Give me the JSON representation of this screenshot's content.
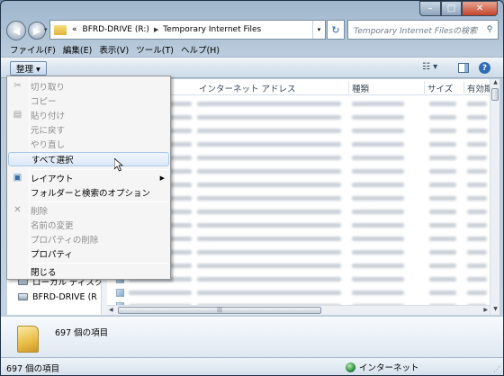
{
  "nav": {
    "address_prefix": "«",
    "address_segments": [
      "BFRD-DRIVE (R:)",
      "Temporary Internet Files"
    ],
    "search_placeholder": "Temporary Internet Filesの検索"
  },
  "window_controls": {
    "minimize": "–",
    "maximize": "□",
    "close": "✕"
  },
  "menubar": [
    "ファイル(F)",
    "編集(E)",
    "表示(V)",
    "ツール(T)",
    "ヘルプ(H)"
  ],
  "toolbar": {
    "organize": "整理 ▾",
    "view_icon": "☷ ▾",
    "help": "?"
  },
  "columns": [
    "インターネット アドレス",
    "種類",
    "サイズ",
    "有効期"
  ],
  "left_pane": {
    "items": [
      "ローカル ディスク",
      "BFRD-DRIVE (R"
    ]
  },
  "context_menu": {
    "items": [
      {
        "label": "切り取り",
        "disabled": true,
        "icon": "scissors-icon"
      },
      {
        "label": "コピー",
        "disabled": true
      },
      {
        "label": "貼り付け",
        "disabled": true,
        "icon": "clipboard-icon"
      },
      {
        "label": "元に戻す",
        "disabled": true
      },
      {
        "label": "やり直し",
        "disabled": true
      },
      {
        "label": "すべて選択",
        "disabled": false
      },
      {
        "label": "レイアウト",
        "disabled": false,
        "icon": "layout-icon",
        "submenu": true
      },
      {
        "label": "フォルダーと検索のオプション",
        "disabled": false
      },
      {
        "label": "削除",
        "disabled": true,
        "icon": "delete-x-icon"
      },
      {
        "label": "名前の変更",
        "disabled": true
      },
      {
        "label": "プロパティの削除",
        "disabled": true
      },
      {
        "label": "プロパティ",
        "disabled": false
      },
      {
        "label": "閉じる",
        "disabled": false
      }
    ]
  },
  "details": {
    "count": "697 個の項目"
  },
  "status": {
    "left": "697 個の項目",
    "zone": "インターネット"
  },
  "colors": {
    "accent": "#2f6cb6",
    "highlight": "#dbe8f8"
  }
}
